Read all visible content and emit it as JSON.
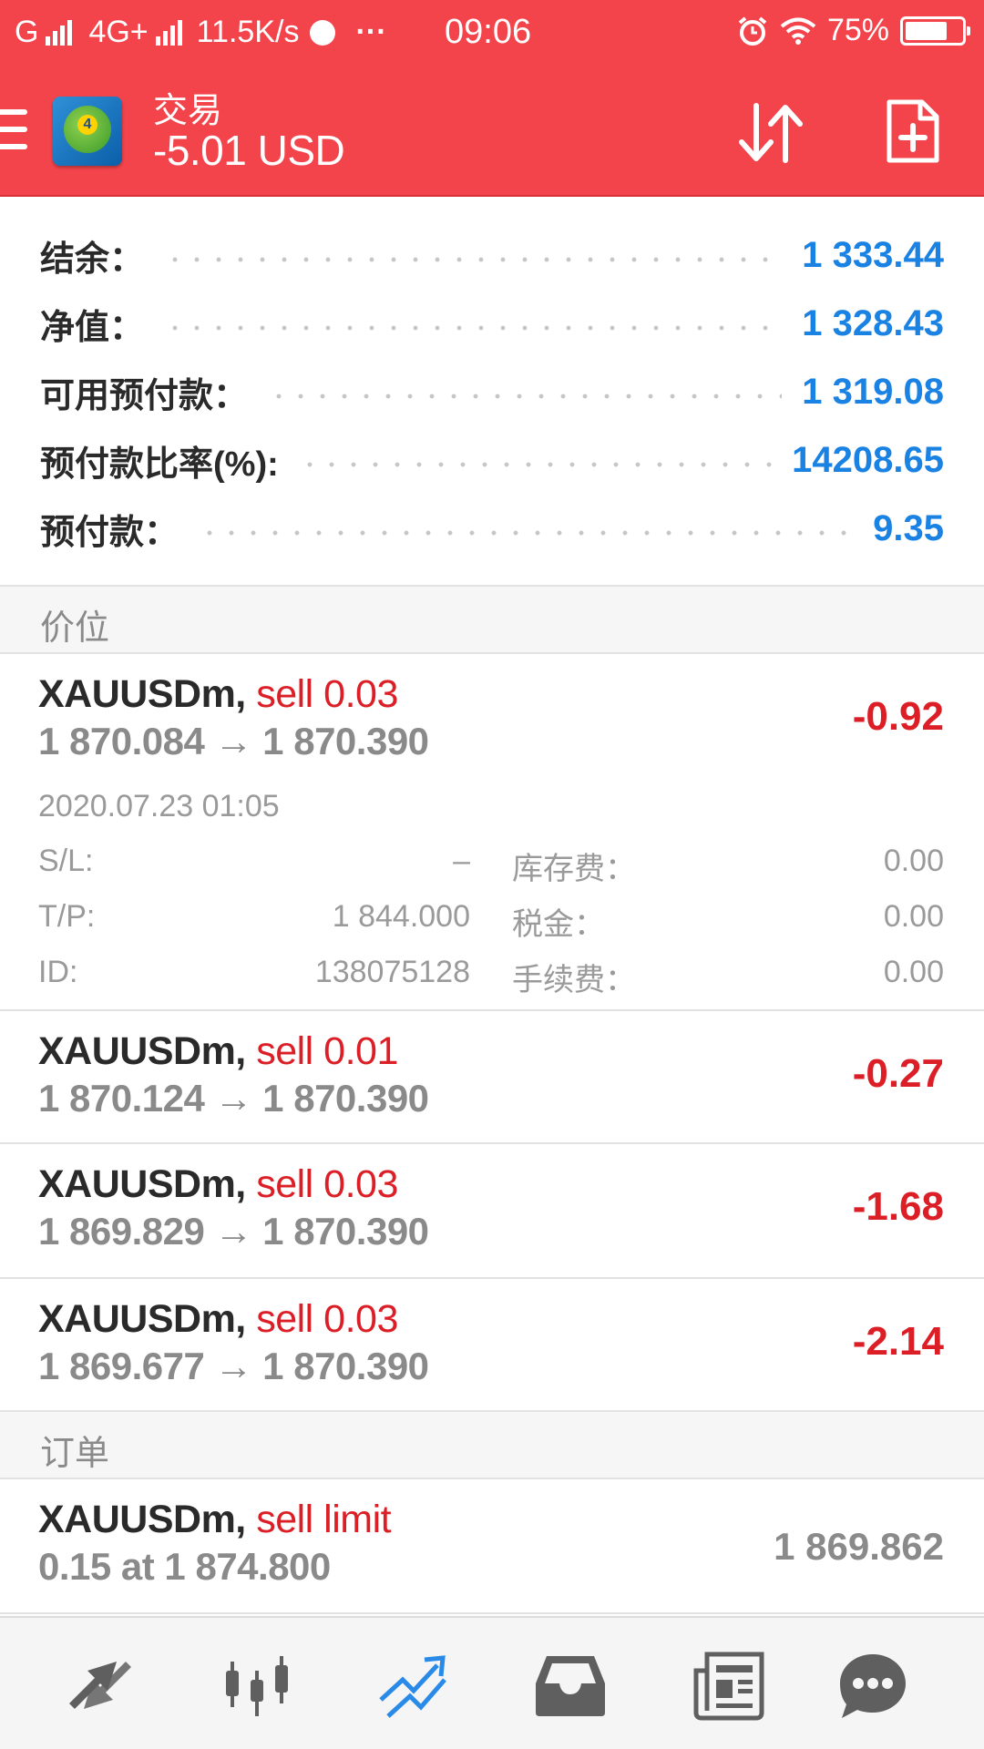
{
  "status_bar": {
    "network": "G",
    "network2": "4G+",
    "speed": "11.5K/s",
    "more": "···",
    "time": "09:06",
    "battery": "75%",
    "battery_level": 0.75
  },
  "app_bar": {
    "title": "交易",
    "subtitle": "-5.01 USD"
  },
  "summary": [
    {
      "label": "结余：",
      "value": "1 333.44"
    },
    {
      "label": "净值：",
      "value": "1 328.43"
    },
    {
      "label": "可用预付款：",
      "value": "1 319.08"
    },
    {
      "label": "预付款比率(%):",
      "value": "14208.65"
    },
    {
      "label": "预付款：",
      "value": "9.35"
    }
  ],
  "positions_header": "价位",
  "positions": [
    {
      "symbol": "XAUUSDm,",
      "side": " sell 0.03",
      "prices": "1 870.084 → 1 870.390",
      "profit": "-0.92",
      "time": "2020.07.23 01:05",
      "details": [
        {
          "k1": "S/L:",
          "v1": "–",
          "k2": "库存费：",
          "v2": "0.00"
        },
        {
          "k1": "T/P:",
          "v1": "1 844.000",
          "k2": "税金：",
          "v2": "0.00"
        },
        {
          "k1": "ID:",
          "v1": "138075128",
          "k2": "手续费：",
          "v2": "0.00"
        }
      ]
    },
    {
      "symbol": "XAUUSDm,",
      "side": " sell 0.01",
      "prices": "1 870.124 → 1 870.390",
      "profit": "-0.27"
    },
    {
      "symbol": "XAUUSDm,",
      "side": " sell 0.03",
      "prices": "1 869.829 → 1 870.390",
      "profit": "-1.68"
    },
    {
      "symbol": "XAUUSDm,",
      "side": " sell 0.03",
      "prices": "1 869.677 → 1 870.390",
      "profit": "-2.14"
    }
  ],
  "orders_header": "订单",
  "orders": [
    {
      "symbol": "XAUUSDm,",
      "side": " sell limit",
      "detail": "0.15 at 1 874.800",
      "price": "1 869.862"
    }
  ],
  "bottom_nav": [
    {
      "icon": "quotes-arrows-icon",
      "active": false
    },
    {
      "icon": "chart-candles-icon",
      "active": false
    },
    {
      "icon": "trade-trend-icon",
      "active": true
    },
    {
      "icon": "history-inbox-icon",
      "active": false
    },
    {
      "icon": "news-icon",
      "active": false
    },
    {
      "icon": "chat-icon",
      "active": false
    }
  ],
  "colors": {
    "brand_red": "#f3444b",
    "value_blue": "#1a82e2",
    "loss_red": "#dc1f26",
    "nav_active": "#2a8ae8",
    "nav_inactive": "#5f5f5f"
  }
}
